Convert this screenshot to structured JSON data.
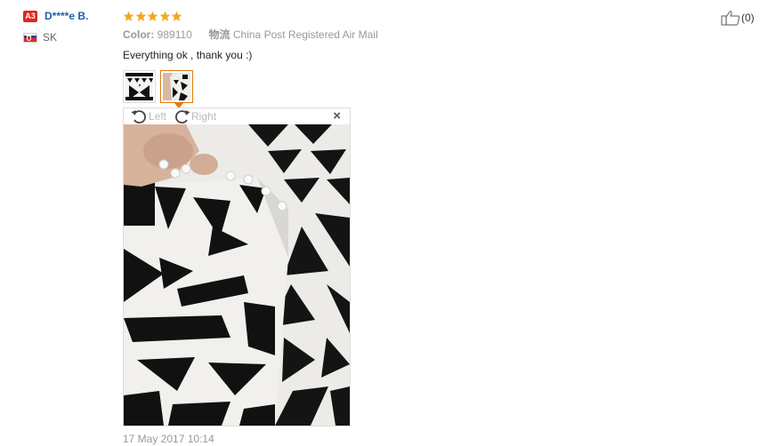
{
  "user": {
    "level": "A3",
    "name": "D****e B.",
    "country": "SK"
  },
  "review": {
    "rating": 5,
    "color_label": "Color:",
    "color_value": "989110",
    "shipping_label": "物流",
    "shipping_value": "China Post Registered Air Mail",
    "feedback": "Everything ok , thank you :)",
    "date": "17 May 2017 10:14"
  },
  "viewer": {
    "rotate_left": "Left",
    "rotate_right": "Right",
    "close": "×"
  },
  "helpful": {
    "count": "(0)"
  },
  "colors": {
    "star": "#f5a623",
    "name": "#1b5faa",
    "level_badge": "#e1251b",
    "active_thumb": "#e07a12"
  }
}
